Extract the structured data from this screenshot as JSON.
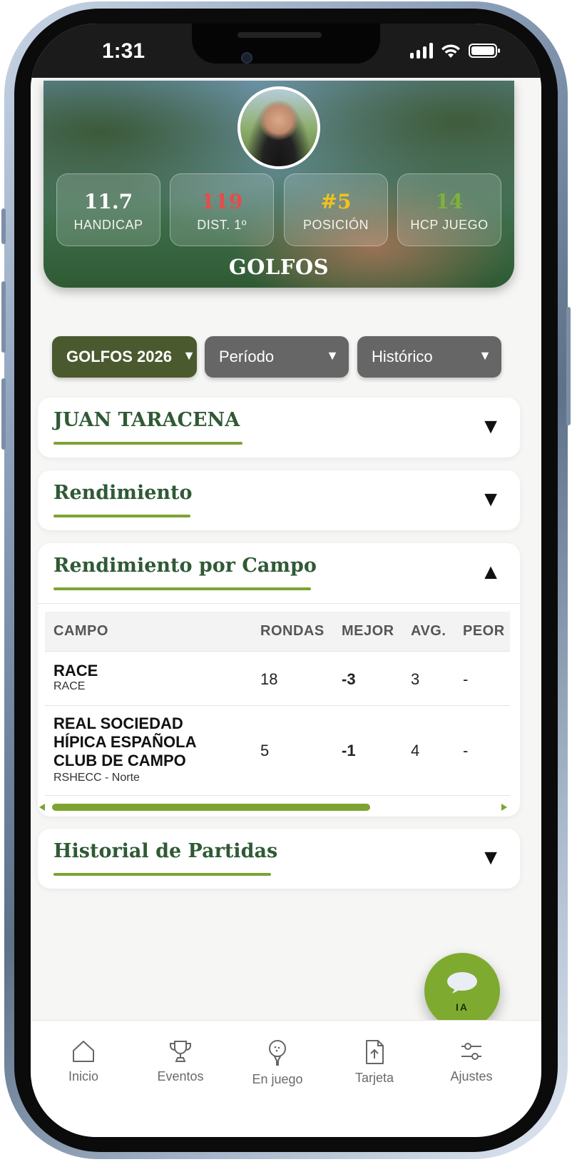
{
  "status_bar": {
    "time": "1:31"
  },
  "profile": {
    "stats": [
      {
        "value": "11.7",
        "label": "HANDICAP",
        "color": "#ffffff"
      },
      {
        "value": "119",
        "label": "DIST. 1º",
        "color": "#e64b4b"
      },
      {
        "value": "#5",
        "label": "POSICIÓN",
        "color": "#f2c318"
      },
      {
        "value": "14",
        "label": "HCP JUEGO",
        "color": "#7fb23a"
      }
    ],
    "club_name": "GOLFOS"
  },
  "filters": {
    "league": "GOLFOS 2026",
    "period": "Período",
    "history": "Histórico"
  },
  "sections": {
    "player": {
      "title": "JUAN TARACENA"
    },
    "performance": {
      "title": "Rendimiento"
    },
    "course_performance": {
      "title": "Rendimiento por Campo",
      "columns": [
        "CAMPO",
        "RONDAS",
        "MEJOR",
        "AVG.",
        "PEOR"
      ],
      "rows": [
        {
          "course": "RACE",
          "subcourse": "RACE",
          "rounds": "18",
          "best": "-3",
          "avg": "3",
          "worst": "-"
        },
        {
          "course_lines": [
            "REAL SOCIEDAD",
            "HÍPICA ESPAÑOLA",
            "CLUB DE CAMPO"
          ],
          "subcourse": "RSHECC - Norte",
          "rounds": "5",
          "best": "-1",
          "avg": "4",
          "worst": "-"
        }
      ]
    },
    "match_history": {
      "title": "Historial de Partidas"
    }
  },
  "fab": {
    "label": "IA"
  },
  "bottom_nav": [
    {
      "label": "Inicio",
      "icon": "home-icon"
    },
    {
      "label": "Eventos",
      "icon": "trophy-icon"
    },
    {
      "label": "En juego",
      "icon": "golf-ball-icon"
    },
    {
      "label": "Tarjeta",
      "icon": "scorecard-upload-icon"
    },
    {
      "label": "Ajustes",
      "icon": "sliders-icon"
    }
  ],
  "colors": {
    "brand_dark_green": "#4b5a2e",
    "accent_green": "#7da332",
    "title_green": "#2f5a35",
    "filter_gray": "#666666"
  }
}
